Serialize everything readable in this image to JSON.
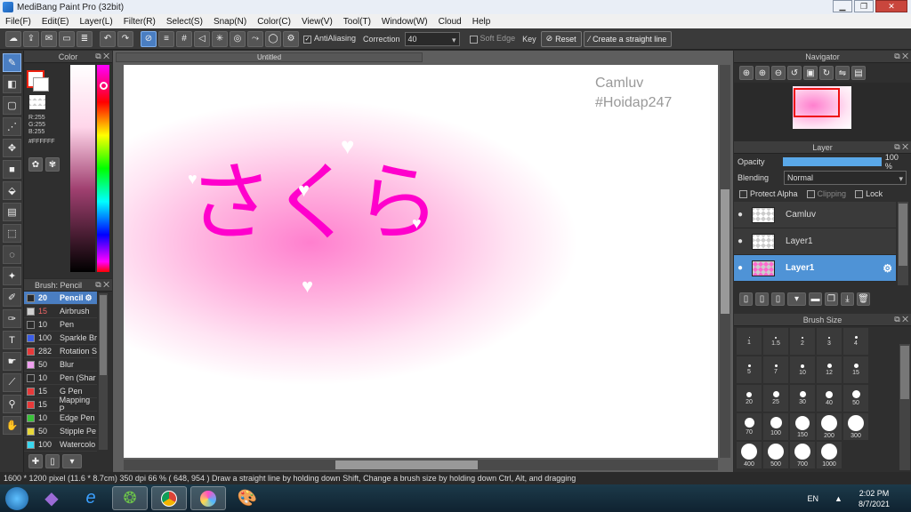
{
  "window": {
    "title": "MediBang Paint Pro (32bit)"
  },
  "menu": [
    "File(F)",
    "Edit(E)",
    "Layer(L)",
    "Filter(R)",
    "Select(S)",
    "Snap(N)",
    "Color(C)",
    "View(V)",
    "Tool(T)",
    "Window(W)",
    "Cloud",
    "Help"
  ],
  "toolbar": {
    "antialiasing_label": "AntiAliasing",
    "correction_label": "Correction",
    "correction_value": "40",
    "soft_edge_label": "Soft Edge",
    "key_label": "Key",
    "reset_label": "Reset",
    "straight_line_label": "Create a straight line"
  },
  "color_panel": {
    "title": "Color",
    "r": "R:255",
    "g": "G:255",
    "b": "B:255",
    "hex": "#FFFFFF"
  },
  "brush_panel": {
    "title": "Brush: Pencil",
    "items": [
      {
        "size": "20",
        "name": "Pencil",
        "color": "#2a2a2a"
      },
      {
        "size": "15",
        "name": "Airbrush",
        "color": "#d0d0d0"
      },
      {
        "size": "10",
        "name": "Pen",
        "color": "#2a2a2a"
      },
      {
        "size": "100",
        "name": "Sparkle Br",
        "color": "#3a5de8"
      },
      {
        "size": "282",
        "name": "Rotation S",
        "color": "#e83a3a"
      },
      {
        "size": "50",
        "name": "Blur",
        "color": "#f0a0f0"
      },
      {
        "size": "10",
        "name": "Pen (Shar",
        "color": "#2a2a2a"
      },
      {
        "size": "15",
        "name": "G Pen",
        "color": "#e83a3a"
      },
      {
        "size": "15",
        "name": "Mapping P",
        "color": "#e83a3a"
      },
      {
        "size": "10",
        "name": "Edge Pen",
        "color": "#3ac23a"
      },
      {
        "size": "50",
        "name": "Stipple Pe",
        "color": "#e8d83a"
      },
      {
        "size": "100",
        "name": "Watercolo",
        "color": "#3ad8f0"
      }
    ]
  },
  "document": {
    "tab": "Untitled",
    "watermark_name": "Camluv",
    "watermark_tag": "#Hoidap247",
    "art_text": "さくら"
  },
  "navigator": {
    "title": "Navigator"
  },
  "layer_panel": {
    "title": "Layer",
    "opacity_label": "Opacity",
    "opacity_value": "100 %",
    "opacity": 1.0,
    "blending_label": "Blending",
    "blending_value": "Normal",
    "protect_alpha": "Protect Alpha",
    "clipping": "Clipping",
    "lock": "Lock",
    "layers": [
      {
        "name": "Camluv"
      },
      {
        "name": "Layer1"
      },
      {
        "name": "Layer1"
      }
    ]
  },
  "brush_size": {
    "title": "Brush Size",
    "sizes": [
      "1",
      "1.5",
      "2",
      "3",
      "4",
      "5",
      "7",
      "10",
      "12",
      "15",
      "20",
      "25",
      "30",
      "40",
      "50",
      "70",
      "100",
      "150",
      "200",
      "300",
      "400",
      "500",
      "700",
      "1000"
    ]
  },
  "status": {
    "text": "1600 * 1200 pixel   (11.6 * 8.7cm)   350 dpi   66 %   ( 648, 954 )   Draw a straight line by holding down Shift, Change a brush size by holding down Ctrl, Alt, and dragging"
  },
  "taskbar": {
    "lang": "EN",
    "time": "2:02 PM",
    "date": "8/7/2021"
  },
  "colors": {
    "accent": "#4a7ec2",
    "art_pink": "#ff00cc",
    "layer_selected": "#4f93d6"
  }
}
